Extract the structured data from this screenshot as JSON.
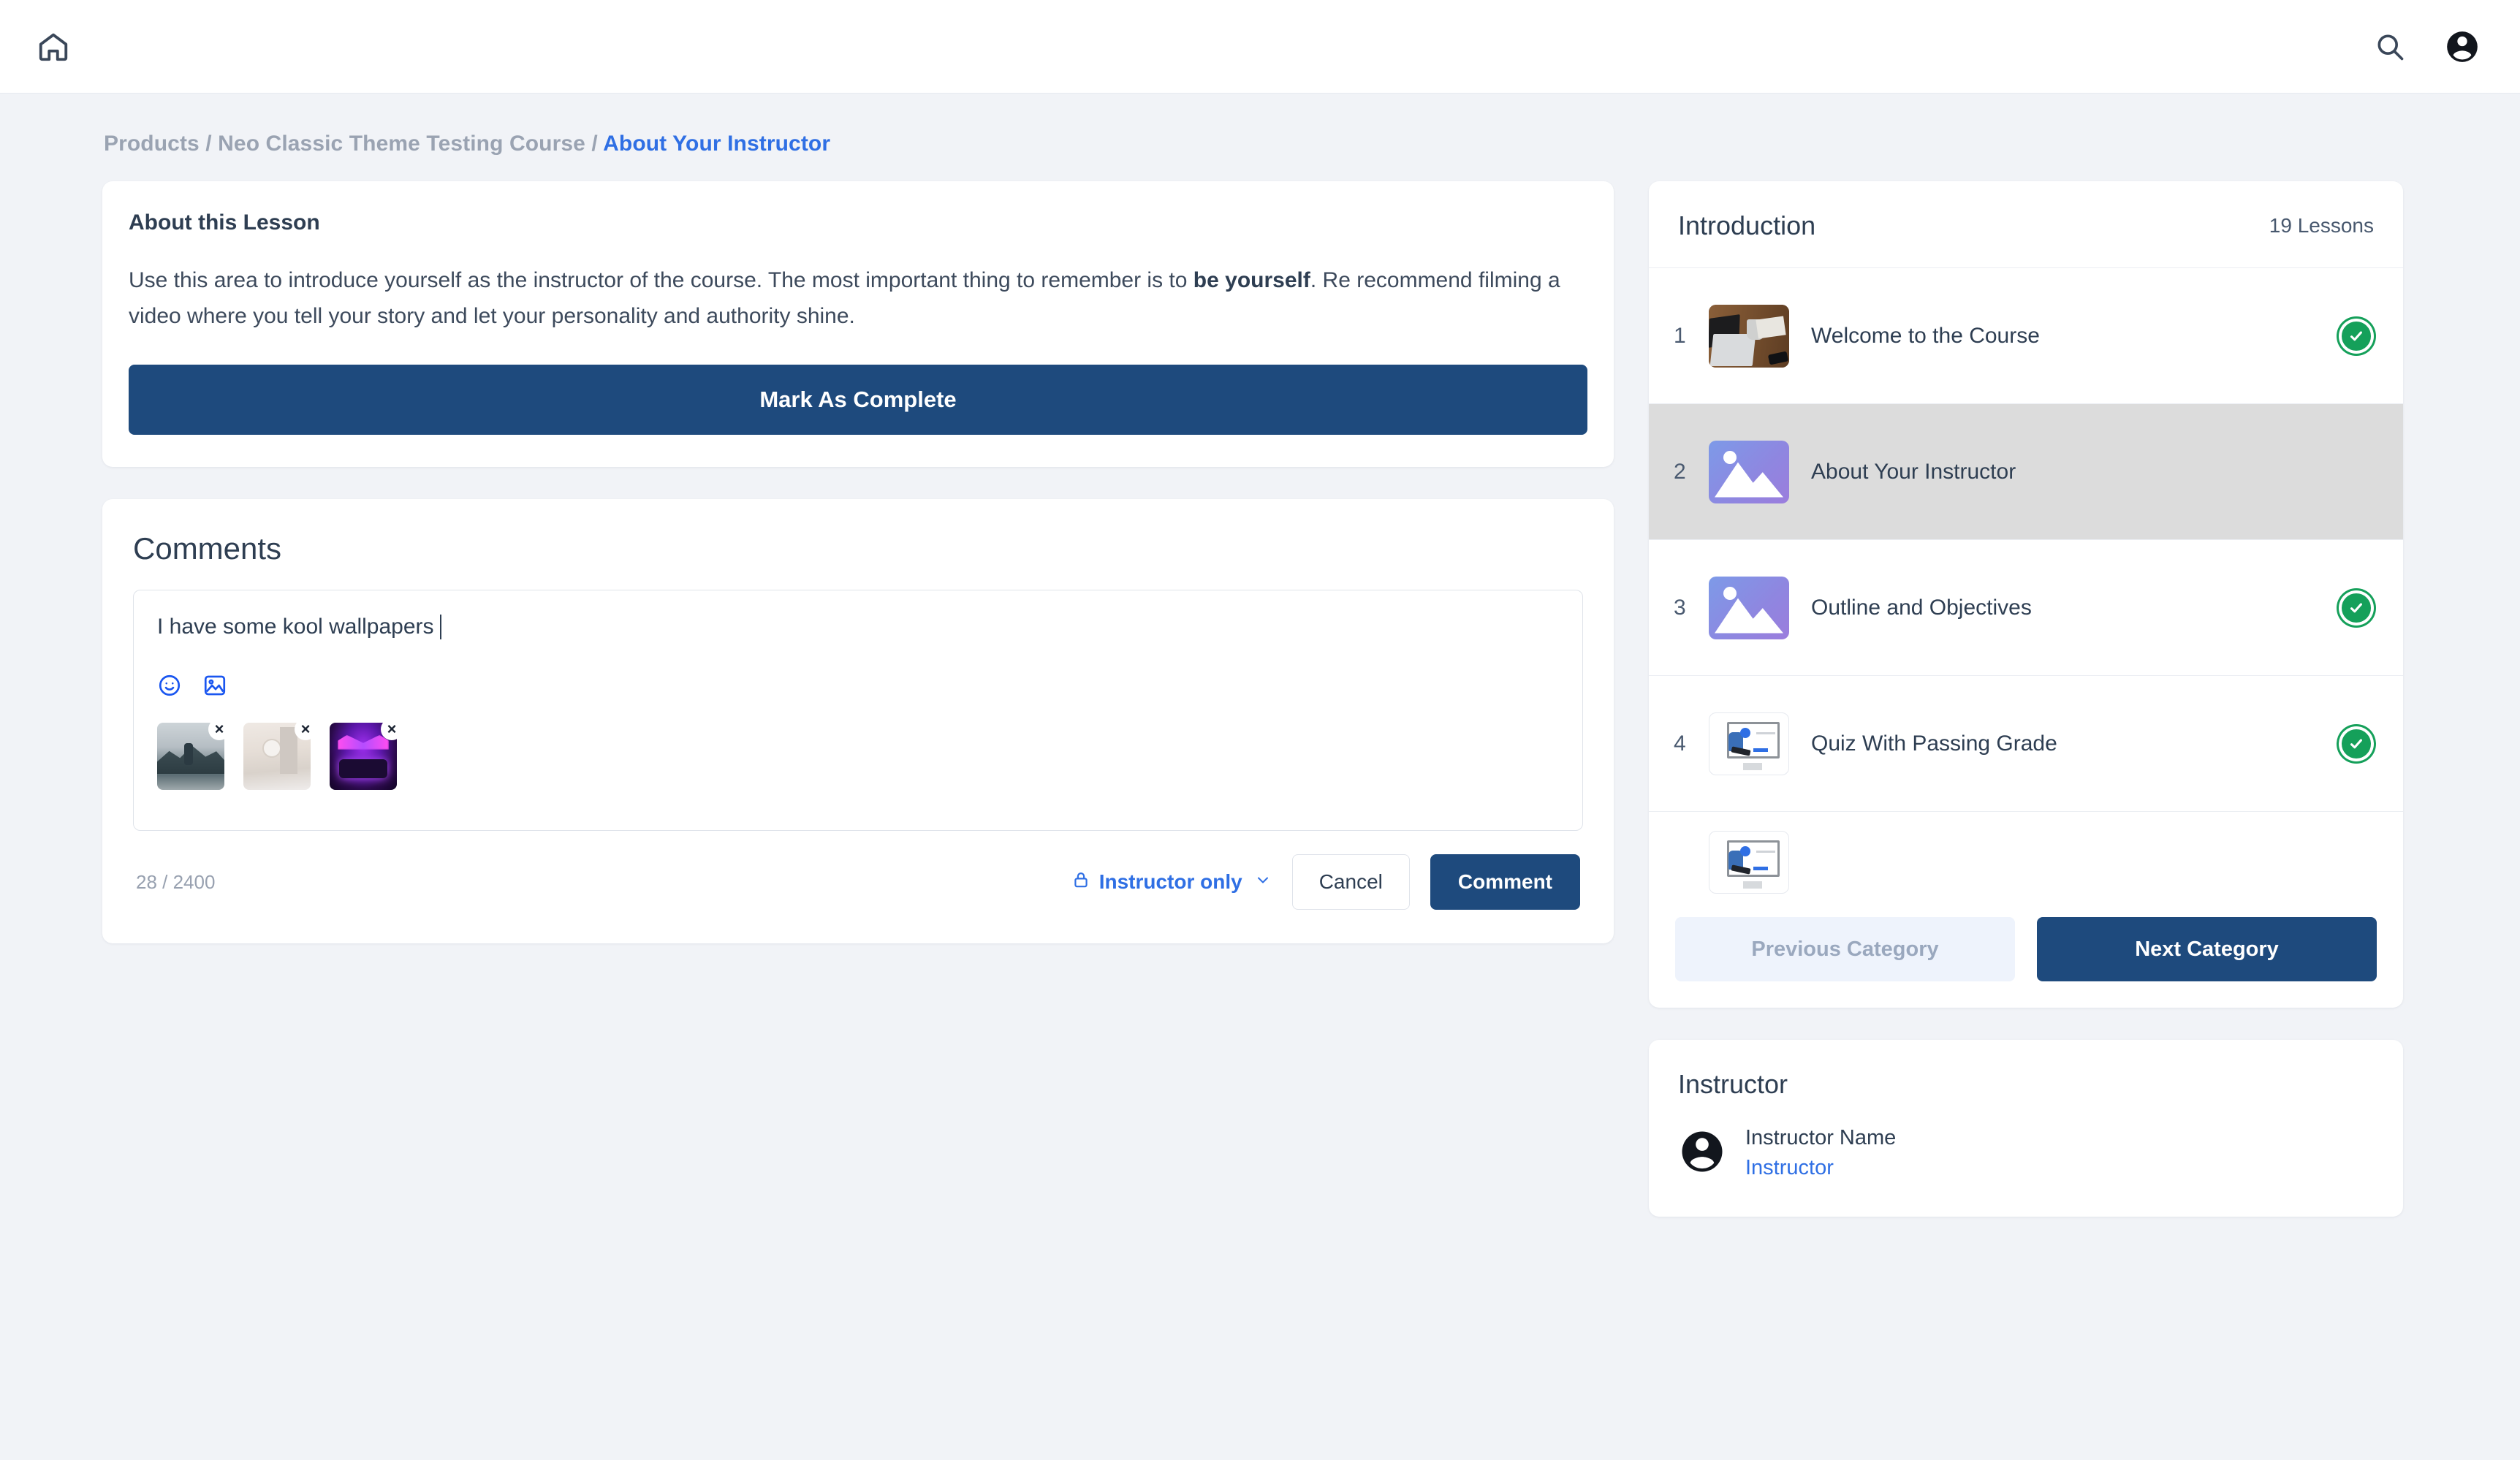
{
  "topbar": {
    "home_icon": "home-icon",
    "search_icon": "search-icon",
    "account_icon": "account-circle-icon"
  },
  "breadcrumb": {
    "item1": "Products",
    "sep1": "/",
    "item2": "Neo Classic Theme Testing Course",
    "sep2": "/",
    "current": "About Your Instructor"
  },
  "lesson": {
    "title": "About this Lesson",
    "body_part1": "Use this area to introduce yourself as the instructor of the course. The most important thing to remember is to ",
    "body_bold": "be yourself",
    "body_part2": ". Re recommend filming a video where you tell your story and let your personality and authority shine.",
    "complete_button": "Mark As Complete"
  },
  "comments": {
    "heading": "Comments",
    "composer_value": "I have some kool wallpapers",
    "emoji_icon": "emoji-smiley-icon",
    "image_icon": "image-upload-icon",
    "attachments": [
      {
        "name": "mountain-wallpaper-thumbnail",
        "remove_label": "×"
      },
      {
        "name": "interior-room-wallpaper-thumbnail",
        "remove_label": "×"
      },
      {
        "name": "neon-car-wallpaper-thumbnail",
        "remove_label": "×"
      }
    ],
    "char_count": "28 / 2400",
    "visibility_label": "Instructor only",
    "visibility_icon": "lock-icon",
    "visibility_chevron": "⌄",
    "cancel_label": "Cancel",
    "submit_label": "Comment"
  },
  "sidebar": {
    "category_title": "Introduction",
    "lesson_count": "19 Lessons",
    "lessons": [
      {
        "num": "1",
        "label": "Welcome to the Course",
        "completed": true,
        "thumb": "desk"
      },
      {
        "num": "2",
        "label": "About Your Instructor",
        "completed": false,
        "thumb": "ph"
      },
      {
        "num": "3",
        "label": "Outline and Objectives",
        "completed": true,
        "thumb": "ph"
      },
      {
        "num": "4",
        "label": "Quiz With Passing Grade",
        "completed": true,
        "thumb": "quiz"
      }
    ],
    "prev_label": "Previous Category",
    "next_label": "Next Category"
  },
  "instructor": {
    "heading": "Instructor",
    "name": "Instructor Name",
    "role": "Instructor",
    "avatar_icon": "account-circle-icon"
  },
  "colors": {
    "primary_navy": "#1e4a7d",
    "link_blue": "#2f6fe4",
    "success_green": "#15a05a",
    "page_bg": "#f1f3f7",
    "active_row": "#dcdcdc"
  }
}
